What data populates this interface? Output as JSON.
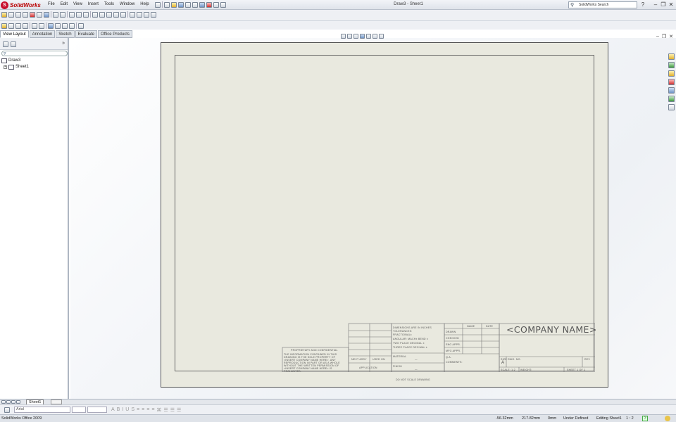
{
  "app": {
    "name": "SolidWorks",
    "window_title": "Draw3 - Sheet1",
    "menus": [
      "File",
      "Edit",
      "View",
      "Insert",
      "Tools",
      "Window",
      "Help"
    ],
    "search_placeholder": "SolidWorks Search",
    "window_controls": [
      "minimize",
      "restore",
      "close"
    ]
  },
  "command_manager": {
    "tabs": [
      "View Layout",
      "Annotation",
      "Sketch",
      "Evaluate",
      "Office Products"
    ],
    "active_tab": "View Layout"
  },
  "feature_tree": {
    "expand_label": "»",
    "items": [
      {
        "label": "Draw3",
        "icon": "drawing-icon"
      },
      {
        "label": "Sheet1",
        "icon": "sheet-icon"
      }
    ]
  },
  "sheet_tabs": {
    "active": "Sheet1"
  },
  "title_block": {
    "company_name": "<COMPANY NAME>",
    "proprietary": [
      "PROPRIETARY AND CONFIDENTIAL",
      "THE INFORMATION CONTAINED IN THIS",
      "DRAWING IS THE SOLE PROPERTY OF",
      "<INSERT COMPANY NAME HERE>. ANY",
      "REPRODUCTION IN PART OR AS A WHOLE",
      "WITHOUT THE WRITTEN PERMISSION OF",
      "<INSERT COMPANY NAME HERE> IS",
      "PROHIBITED."
    ],
    "next_assy": "NEXT ASSY",
    "used_on": "USED ON",
    "application": "APPLICATION",
    "dimensions": [
      "DIMENSIONS ARE IN INCHES",
      "TOLERANCES:",
      "FRACTIONAL±",
      "ANGULAR: MACH±   BEND ±",
      "TWO PLACE DECIMAL   ±",
      "THREE PLACE DECIMAL  ±"
    ],
    "material": "MATERIAL",
    "finish": "FINISH",
    "dash": "—",
    "do_not_scale": "DO NOT SCALE DRAWING",
    "name_header": "NAME",
    "date_header": "DATE",
    "roles": [
      "DRAWN",
      "CHECKED",
      "ENG APPR.",
      "MFG APPR.",
      "Q.A.",
      "COMMENTS:"
    ],
    "size_label": "SIZE",
    "size_value": "A",
    "dwg_no": "DWG.  NO.",
    "rev": "REV",
    "scale": "SCALE: 1:2",
    "weight": "WEIGHT:",
    "sheet": "SHEET 1 OF 1"
  },
  "format_bar": {
    "font": "Arial"
  },
  "status": {
    "product": "SolidWorks Office 2009",
    "x": "-56.32mm",
    "y": "217.82mm",
    "z": "0mm",
    "state": "Under Defined",
    "editing": "Editing Sheet1",
    "scale": "1 : 2"
  }
}
